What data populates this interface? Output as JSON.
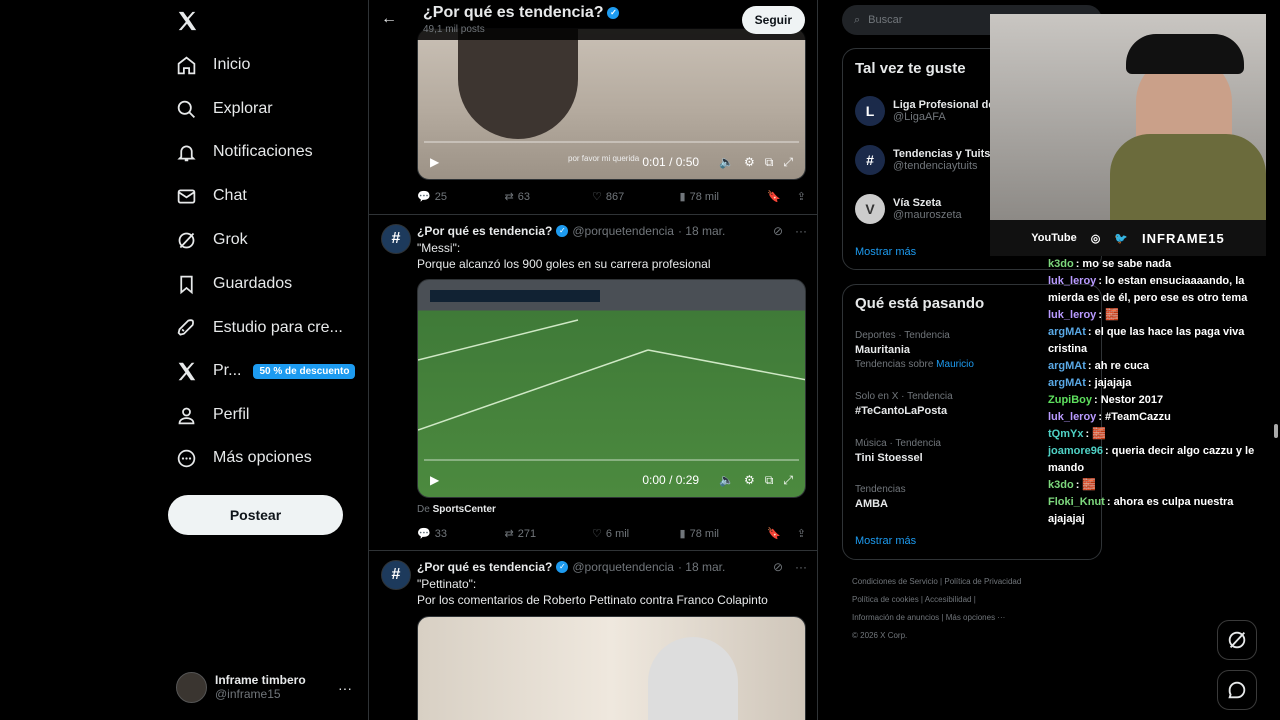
{
  "nav": {
    "items": [
      {
        "label": "Inicio",
        "icon": "home-icon"
      },
      {
        "label": "Explorar",
        "icon": "search-icon"
      },
      {
        "label": "Notificaciones",
        "icon": "bell-icon"
      },
      {
        "label": "Chat",
        "icon": "mail-icon"
      },
      {
        "label": "Grok",
        "icon": "grok-icon"
      },
      {
        "label": "Guardados",
        "icon": "bookmark-icon"
      },
      {
        "label": "Estudio para cre...",
        "icon": "rocket-icon"
      },
      {
        "label": "Pr...",
        "icon": "x-logo-icon",
        "badge": "50 % de descuento"
      },
      {
        "label": "Perfil",
        "icon": "person-icon"
      },
      {
        "label": "Más opciones",
        "icon": "more-circle-icon"
      }
    ],
    "post_label": "Postear",
    "account": {
      "name": "Inframe timbero",
      "handle": "@inframe15"
    }
  },
  "feed": {
    "title": "¿Por qué es tendencia?",
    "subtitle": "49,1 mil posts",
    "follow_label": "Seguir",
    "video1": {
      "time": "0:01 / 0:50",
      "caption": "por favor mi querida"
    },
    "actions1": {
      "replies": "25",
      "reposts": "63",
      "likes": "867",
      "views": "78 mil"
    },
    "tweet2": {
      "name": "¿Por qué es tendencia?",
      "handle": "@porquetendencia",
      "date": "· 18 mar.",
      "line1": "\"Messi\":",
      "line2": "Porque alcanzó los 900 goles en su carrera profesional",
      "video_time": "0:00 / 0:29",
      "source_prefix": "De",
      "source_name": "SportsCenter",
      "replies": "33",
      "reposts": "271",
      "likes": "6 mil",
      "views": "78 mil"
    },
    "tweet3": {
      "name": "¿Por qué es tendencia?",
      "handle": "@porquetendencia",
      "date": "· 18 mar.",
      "line1": "\"Pettinato\":",
      "line2": "Por los comentarios de Roberto Pettinato contra Franco Colapinto"
    }
  },
  "right": {
    "search_placeholder": "Buscar",
    "suggest_title": "Tal vez te guste",
    "suggestions": [
      {
        "name": "Liga Profesional de",
        "handle": "@LigaAFA"
      },
      {
        "name": "Tendencias y Tuits",
        "handle": "@tendenciaytuits"
      },
      {
        "name": "Vía Szeta",
        "handle": "@mauroszeta"
      }
    ],
    "show_more": "Mostrar más",
    "trends_title": "Qué está pasando",
    "trends": [
      {
        "cat": "Deportes · Tendencia",
        "name": "Mauritania",
        "extra_prefix": "Tendencias sobre",
        "extra_link": "Mauricio"
      },
      {
        "cat": "Solo en X · Tendencia",
        "name": "#TeCantoLaPosta"
      },
      {
        "cat": "Música · Tendencia",
        "name": "Tini Stoessel"
      },
      {
        "cat": "Tendencias",
        "name": "AMBA"
      }
    ],
    "trends_more": "Mostrar más",
    "footer": {
      "l1a": "Condiciones de Servicio",
      "l1b": "Política de Privacidad",
      "l2a": "Política de cookies",
      "l2b": "Accesibilidad",
      "l3a": "Información de anuncios",
      "l3b": "Más opciones ···",
      "l4": "© 2026 X Corp."
    }
  },
  "stream": {
    "social_youtube": "YouTube",
    "handle": "INFRAME15",
    "chat": [
      {
        "user": "k3do",
        "color": "#7dd87d",
        "msg": ": mo se sabe nada"
      },
      {
        "user": "luk_leroy",
        "color": "#b99bff",
        "msg": ": lo estan ensuciaaaando, la mierda es de él, pero ese es otro tema"
      },
      {
        "user": "luk_leroy",
        "color": "#b99bff",
        "msg": ": 🧱"
      },
      {
        "user": "argMAt",
        "color": "#5aa9e6",
        "msg": ": el que las hace las paga viva cristina"
      },
      {
        "user": "argMAt",
        "color": "#5aa9e6",
        "msg": ": ah re cuca"
      },
      {
        "user": "argMAt",
        "color": "#5aa9e6",
        "msg": ": jajajaja"
      },
      {
        "user": "ZupiBoy",
        "color": "#5ee05e",
        "msg": ": Nestor 2017"
      },
      {
        "user": "luk_leroy",
        "color": "#b99bff",
        "msg": ": #TeamCazzu"
      },
      {
        "user": "tQmYx",
        "color": "#4fd1c5",
        "msg": ": 🧱"
      },
      {
        "user": "joamore96",
        "color": "#4fd1c5",
        "msg": ": queria decir algo cazzu y le mando"
      },
      {
        "user": "k3do",
        "color": "#7dd87d",
        "msg": ": 🧱"
      },
      {
        "user": "Floki_Knut",
        "color": "#7dd87d",
        "msg": ": ahora es culpa nuestra ajajajaj"
      }
    ]
  }
}
